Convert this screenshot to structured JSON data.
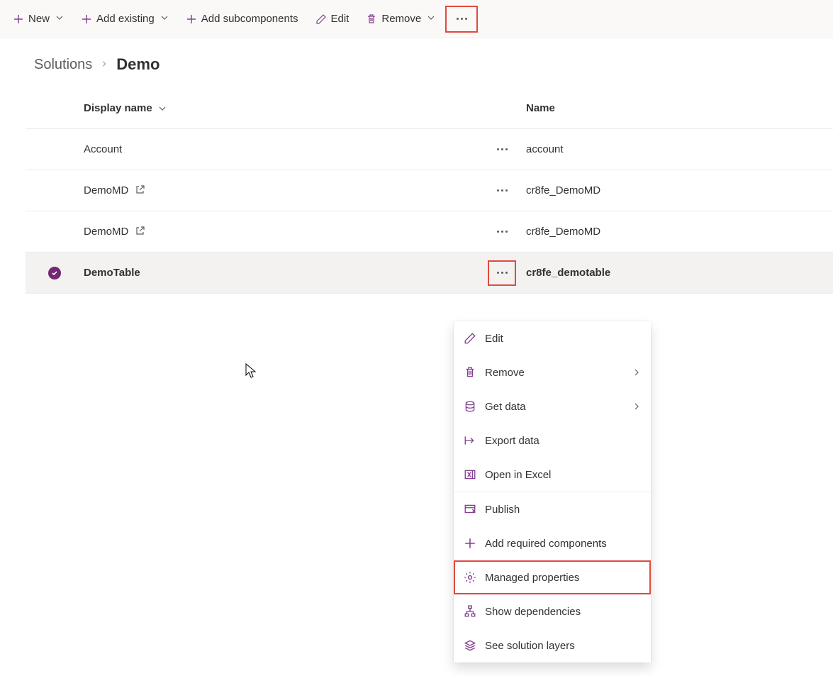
{
  "toolbar": {
    "new_label": "New",
    "add_existing_label": "Add existing",
    "add_subcomponents_label": "Add subcomponents",
    "edit_label": "Edit",
    "remove_label": "Remove"
  },
  "breadcrumb": {
    "root": "Solutions",
    "current": "Demo"
  },
  "columns": {
    "display_name": "Display name",
    "name": "Name"
  },
  "rows": [
    {
      "display_name": "Account",
      "has_external_link": false,
      "name": "account",
      "selected": false
    },
    {
      "display_name": "DemoMD",
      "has_external_link": true,
      "name": "cr8fe_DemoMD",
      "selected": false
    },
    {
      "display_name": "DemoMD",
      "has_external_link": true,
      "name": "cr8fe_DemoMD",
      "selected": false
    },
    {
      "display_name": "DemoTable",
      "has_external_link": false,
      "name": "cr8fe_demotable",
      "selected": true
    }
  ],
  "context_menu": {
    "edit": "Edit",
    "remove": "Remove",
    "get_data": "Get data",
    "export_data": "Export data",
    "open_in_excel": "Open in Excel",
    "publish": "Publish",
    "add_required_components": "Add required components",
    "managed_properties": "Managed properties",
    "show_dependencies": "Show dependencies",
    "see_solution_layers": "See solution layers"
  }
}
